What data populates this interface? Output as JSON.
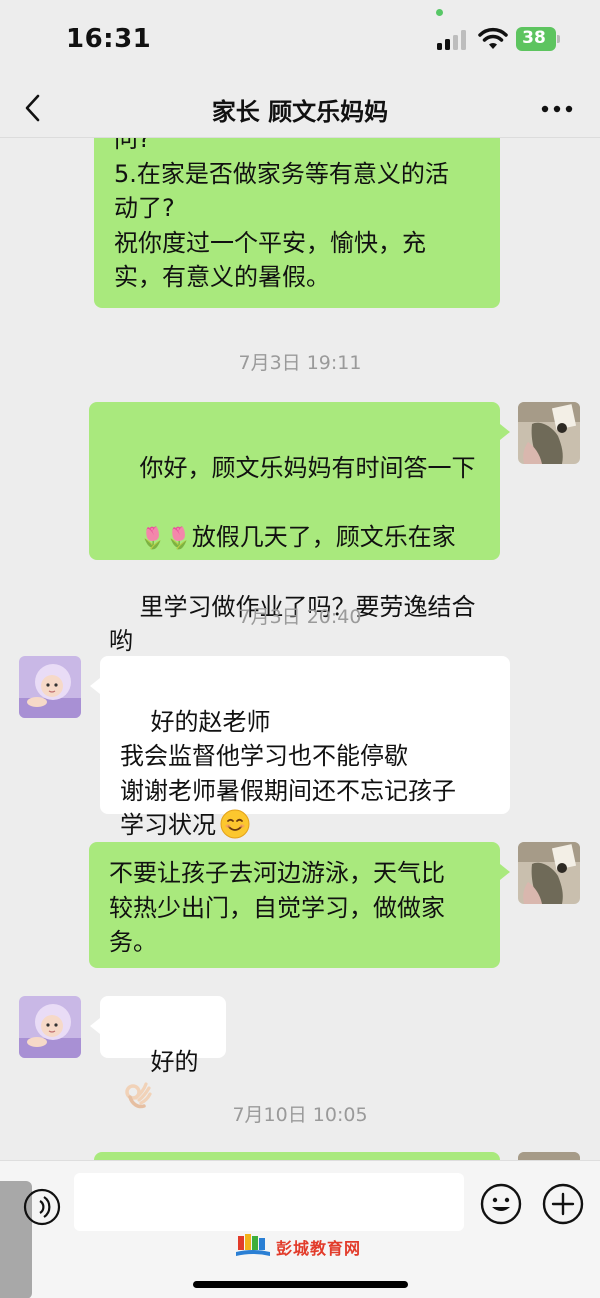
{
  "status_bar": {
    "time": "16:31",
    "battery": "38"
  },
  "nav": {
    "title": "家长 顾文乐妈妈"
  },
  "messages": {
    "m1": "问?\n5.在家是否做家务等有意义的活\n动了?\n祝你度过一个平安，愉快，充\n实，有意义的暑假。",
    "t1": "7月3日 19:11",
    "m2_line1": "你好，顾文乐妈妈有时间答一下",
    "m2_line2_prefix": "🌷🌷",
    "m2_line2": "放假几天了，顾文乐在家",
    "m2_rest": "里学习做作业了吗？要劳逸结合\n哟",
    "t2": "7月3日 20:40",
    "m3": "好的赵老师\n我会监督他学习也不能停歇\n谢谢老师暑假期间还不忘记孩子\n学习状况",
    "m4": "不要让孩子去河边游泳，天气比\n较热少出门，自觉学习，做做家\n务。",
    "m5": "好的",
    "t3": "7月10日 10:05"
  },
  "input": {
    "placeholder": ""
  },
  "watermark": {
    "text": "彭城教育网"
  },
  "colors": {
    "sent_bubble": "#a9e97d",
    "received_bubble": "#ffffff",
    "background": "#ededed"
  }
}
